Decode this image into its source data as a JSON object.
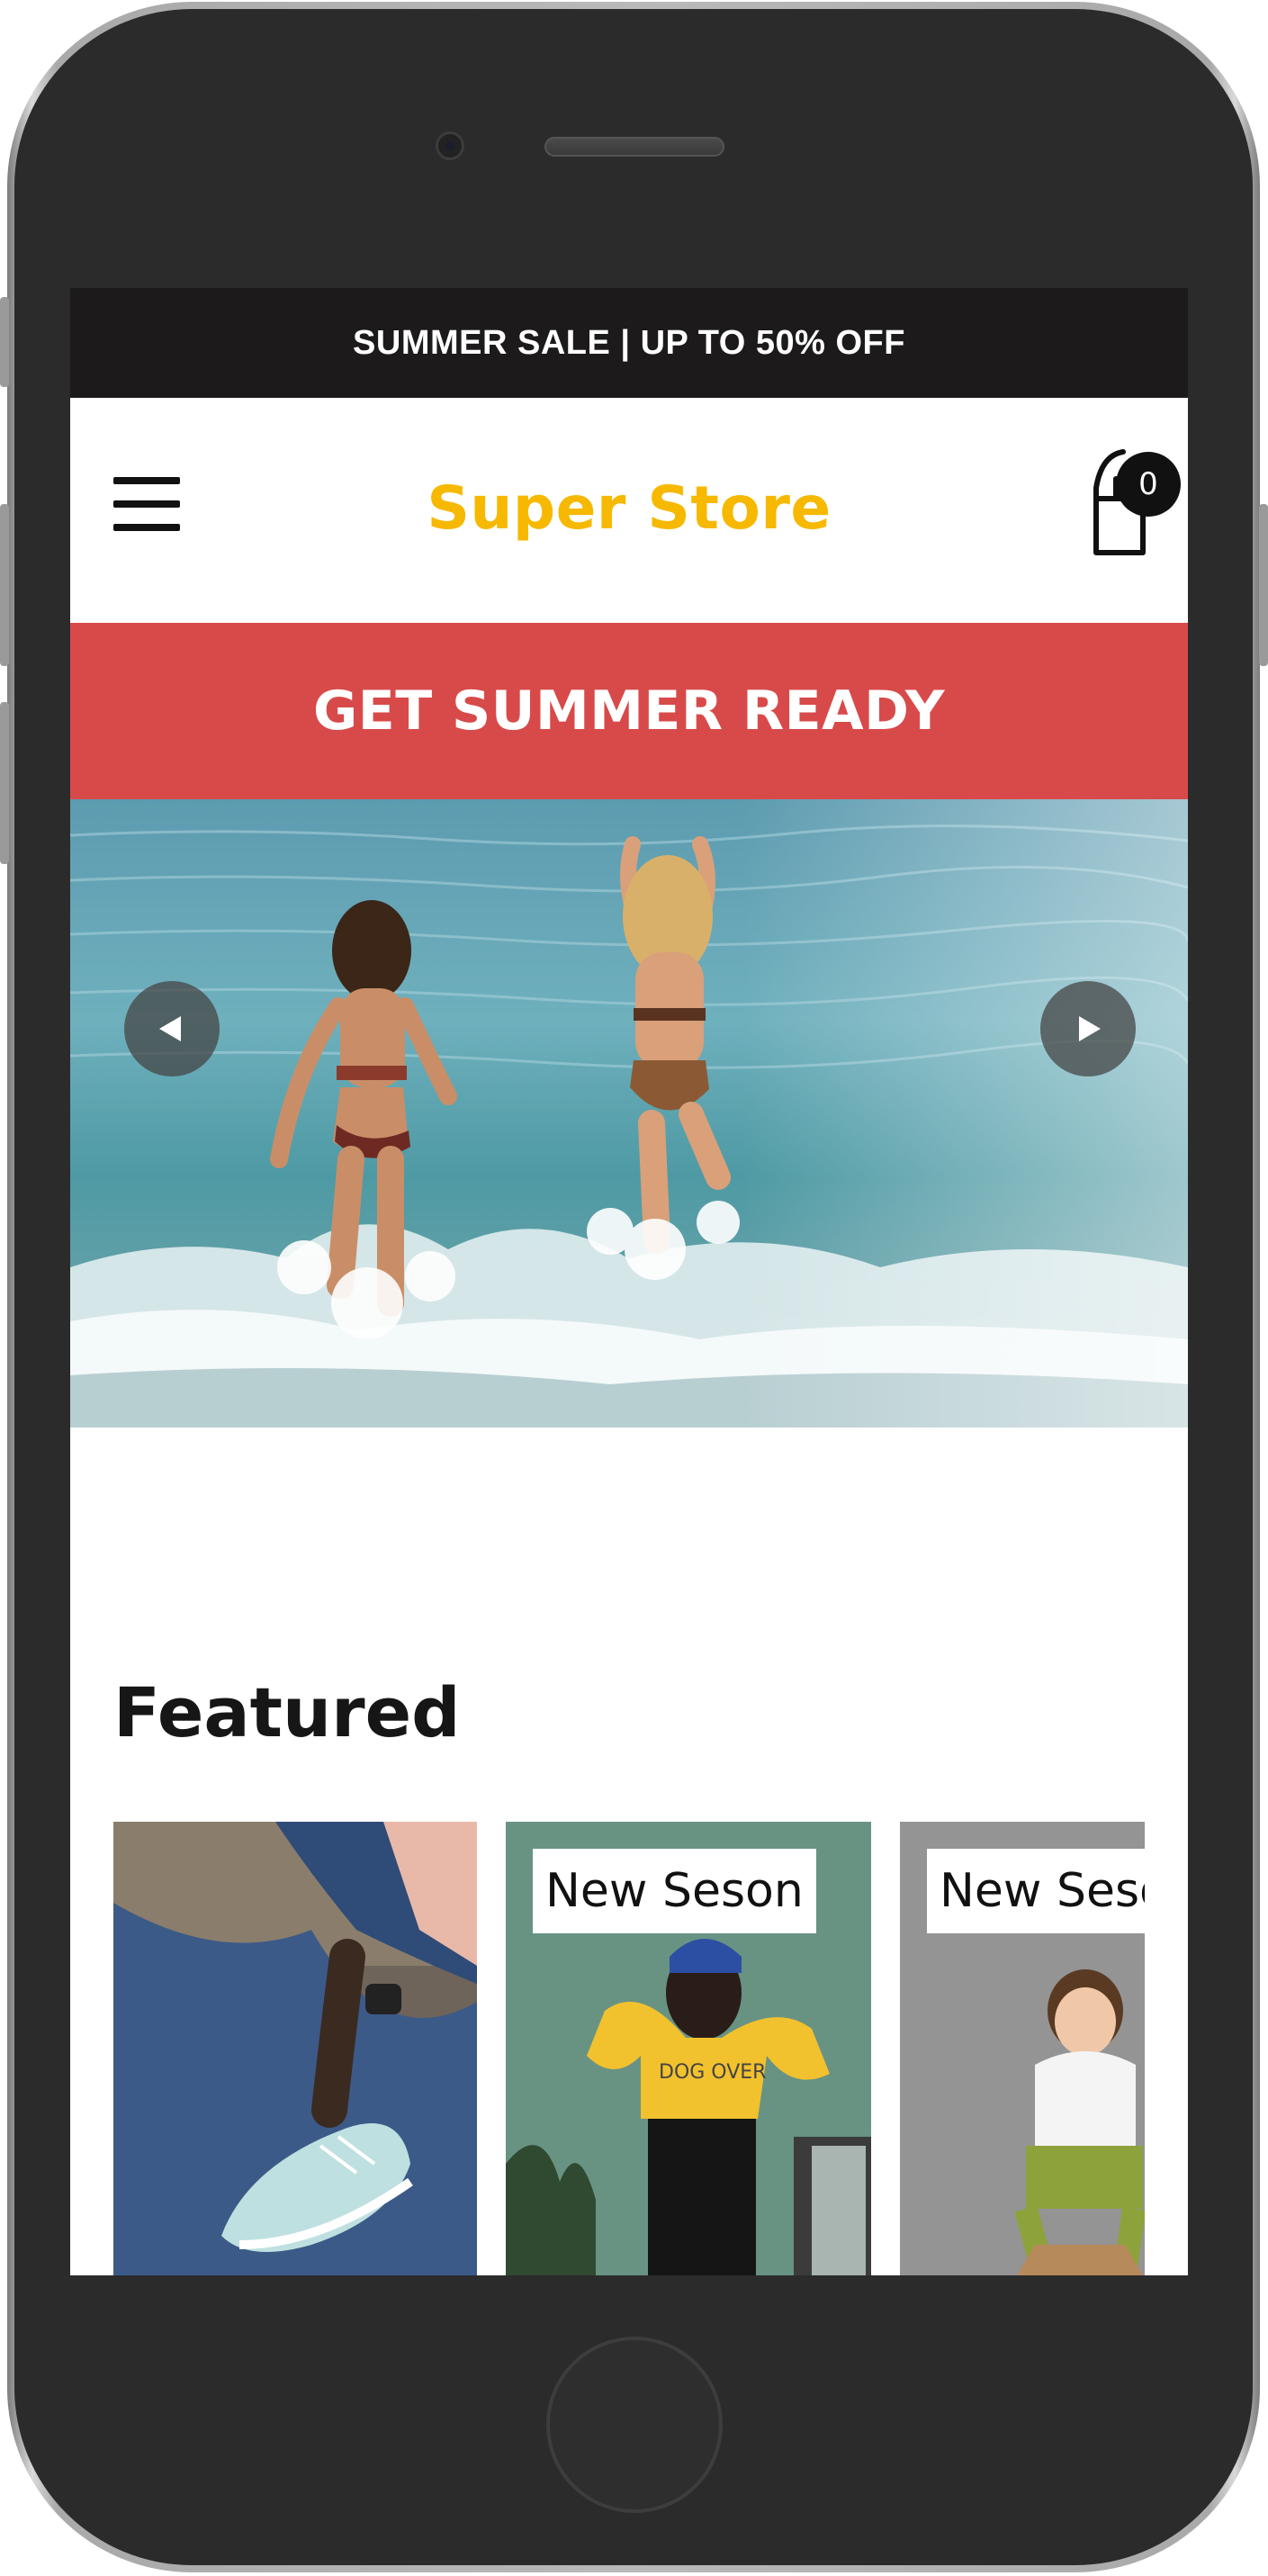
{
  "promo_bar": {
    "text": "SUMMER SALE | UP TO 50% OFF"
  },
  "header": {
    "brand": "Super Store",
    "menu_icon": "hamburger-menu-icon",
    "cart_icon": "shopping-bag-icon",
    "cart_count": "0"
  },
  "banner": {
    "text": "GET SUMMER READY"
  },
  "hero": {
    "image": "two-women-running-into-sea-photo",
    "prev_icon": "arrow-left-icon",
    "next_icon": "arrow-right-icon"
  },
  "featured": {
    "title": "Featured",
    "products": [
      {
        "image": "person-putting-on-sneaker-photo",
        "tag": ""
      },
      {
        "image": "woman-in-yellow-sweatshirt-photo",
        "tag": "New Seson"
      },
      {
        "image": "boy-sitting-on-stool-photo",
        "tag": "New Seson"
      }
    ]
  },
  "colors": {
    "promo_bg": "#1c1a1a",
    "brand": "#f7b800",
    "banner_bg": "#d84a4a",
    "phone_body": "#2b2b2b"
  }
}
